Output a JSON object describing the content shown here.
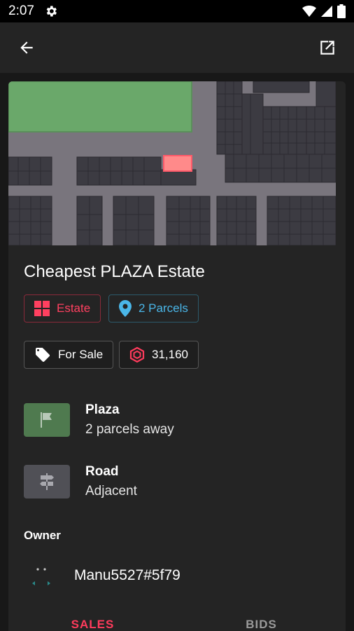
{
  "status_bar": {
    "time": "2:07"
  },
  "parcel": {
    "title": "Cheapest PLAZA Estate",
    "type_label": "Estate",
    "parcels_label": "2 Parcels",
    "sale_label": "For Sale",
    "price": "31,160"
  },
  "proximity": [
    {
      "title": "Plaza",
      "subtitle": "2 parcels away"
    },
    {
      "title": "Road",
      "subtitle": "Adjacent"
    }
  ],
  "owner": {
    "label": "Owner",
    "name": "Manu5527#5f79"
  },
  "tabs": {
    "sales": "SALES",
    "bids": "BIDS"
  },
  "colors": {
    "accent": "#ff3b5c",
    "parcels_blue": "#4ab6e8",
    "plaza_green": "#6aa86a",
    "highlight_parcel": "#ff8a8a"
  },
  "icons": {
    "back": "arrow-left-icon",
    "open_external": "open-external-icon",
    "estate": "grid-icon",
    "parcels": "location-pin-icon",
    "sale": "tag-icon",
    "price": "mana-hexagon-icon",
    "plaza": "flag-icon",
    "road": "signpost-icon"
  }
}
